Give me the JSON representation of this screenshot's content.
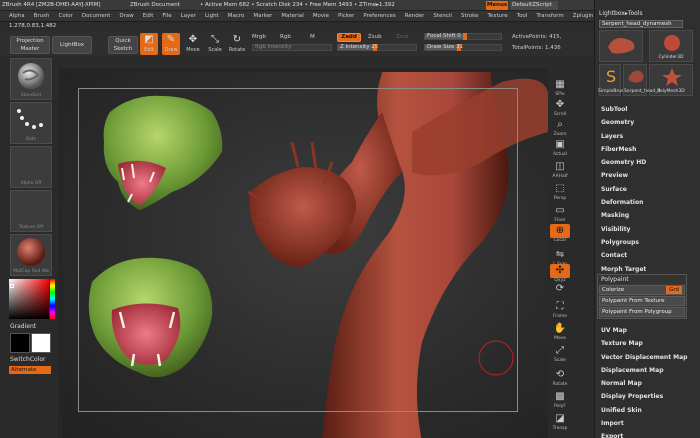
{
  "titlebar": {
    "app": "ZBrush 4R4 [ZM2B-DHEI-AAYJ-XPIM]",
    "document": "ZBrush Document",
    "stats": "• Active Mem 682 • Scratch Disk 234 • Free Mem 3493 • ZTime▸1.392",
    "menus_button": "Menus",
    "script_button": "DefaultZScript"
  },
  "menubar": [
    "Alpha",
    "Brush",
    "Color",
    "Document",
    "Draw",
    "Edit",
    "File",
    "Layer",
    "Light",
    "Macro",
    "Marker",
    "Material",
    "Movie",
    "Picker",
    "Preferences",
    "Render",
    "Stencil",
    "Stroke",
    "Texture",
    "Tool",
    "Transform",
    "Zplugin",
    "Zscript"
  ],
  "coords": "1.278,0.83,1.482",
  "shelf": {
    "projection_master": "Projection Master",
    "lightbox": "LightBox",
    "quick_sketch": "Quick Sketch",
    "tools": [
      {
        "label": "Edit",
        "icon": "edit-icon",
        "active": true
      },
      {
        "label": "Draw",
        "icon": "draw-icon",
        "active": true
      },
      {
        "label": "Move",
        "icon": "move-icon",
        "active": false
      },
      {
        "label": "Scale",
        "icon": "scale-icon",
        "active": false
      },
      {
        "label": "Rotate",
        "icon": "rotate-icon",
        "active": false
      }
    ],
    "mrgb": "Mrgb",
    "rgb": "Rgb",
    "m": "M",
    "zadd": "Zadd",
    "zsub": "Zsub",
    "zcut": "Zcut",
    "rgb_intensity": "Rgb Intensity",
    "z_intensity": "Z Intensity 25",
    "focal_shift": "Focal Shift 0",
    "draw_size": "Draw Size 31",
    "active_points": "ActivePoints: 415,",
    "total_points": "TotalPoints: 1.436"
  },
  "left_tray": [
    {
      "caption": "Standard"
    },
    {
      "caption": "Dots"
    },
    {
      "caption": "Alpha Off"
    },
    {
      "caption": "Texture Off"
    },
    {
      "caption": "MatCap Red Wa"
    }
  ],
  "gradient_label": "Gradient",
  "switch_color_label": "SwitchColor",
  "alternate_label": "Alternate",
  "right_strip": [
    {
      "label": "SPix",
      "icon": "spix-icon"
    },
    {
      "label": "Scroll",
      "icon": "scroll-icon"
    },
    {
      "label": "Zoom",
      "icon": "zoom-icon"
    },
    {
      "label": "Actual",
      "icon": "actual-icon"
    },
    {
      "label": "AAHalf",
      "icon": "aahalf-icon"
    },
    {
      "label": "Persp",
      "icon": "persp-icon"
    },
    {
      "label": "Floor",
      "icon": "floor-icon"
    },
    {
      "label": "Local",
      "icon": "local-icon"
    },
    {
      "label": "L.Sym",
      "icon": "lsym-icon"
    },
    {
      "label": "Qxyz",
      "icon": "xyz-icon"
    },
    {
      "label": "",
      "icon": "axis-icon"
    },
    {
      "label": "Frame",
      "icon": "frame-icon"
    },
    {
      "label": "Move",
      "icon": "move-view-icon"
    },
    {
      "label": "Scale",
      "icon": "scale-view-icon"
    },
    {
      "label": "Rotate",
      "icon": "rotate-view-icon"
    },
    {
      "label": "PolyF",
      "icon": "polyf-icon"
    },
    {
      "label": "Transp",
      "icon": "transp-icon"
    }
  ],
  "right_panel": {
    "title": "Lightbox▸Tools",
    "selected_tool": "Serpent_head_dynamesh",
    "tools": [
      {
        "caption": "",
        "color": "#c05a4a"
      },
      {
        "caption": "Cylinder3D",
        "color": "#c04a3a"
      },
      {
        "caption": "PolyMesh3D",
        "color": "#c0503a"
      },
      {
        "caption": "SimpleBrush",
        "color": "#e8a030"
      },
      {
        "caption": "Serpent_head_d",
        "color": "#a04838"
      }
    ],
    "palettes": [
      "SubTool",
      "Geometry",
      "Layers",
      "FiberMesh",
      "Geometry HD",
      "Preview",
      "Surface",
      "Deformation",
      "Masking",
      "Visibility",
      "Polygroups",
      "Contact",
      "Morph Target"
    ],
    "polypaint": {
      "header": "Polypaint",
      "colorize": "Colorize",
      "grd": "Grd",
      "from_texture": "Polypaint From Texture",
      "from_polygroup": "Polypaint From Polygroup"
    },
    "palettes2": [
      "UV Map",
      "Texture Map",
      "Vector Displacement Map",
      "Displacement Map",
      "Normal Map",
      "Display Properties",
      "Unified Skin",
      "Import",
      "Export"
    ]
  }
}
